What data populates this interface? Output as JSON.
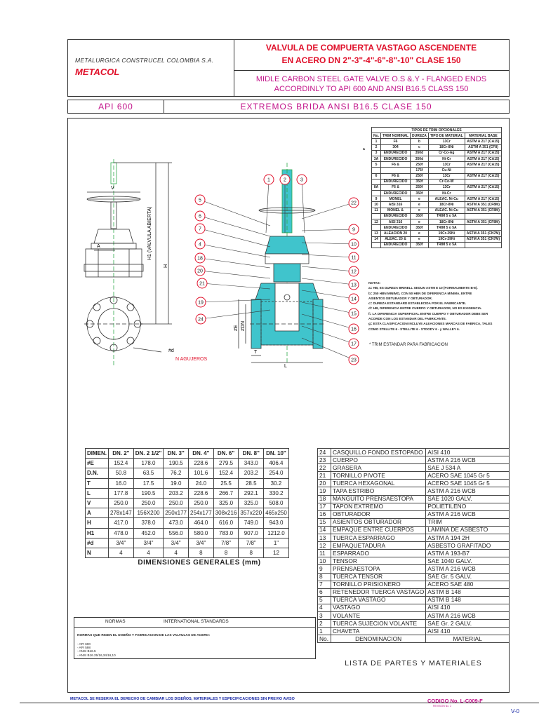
{
  "header": {
    "company": "METALURGICA CONSTRUCEL COLOMBIA S.A.",
    "brand": "METACOL",
    "title_line1": "VALVULA DE COMPUERTA VASTAGO ASCENDENTE",
    "title_line2": "EN ACERO DN 2\"-3\"-4\"-6\"-8\"-10\" CLASE 150",
    "subtitle_line1": "MIDLE CARBON STEEL GATE VALVE O.S &.Y - FLANGED ENDS",
    "subtitle_line2": "ACCORDINLY TO API 600 AND ANSI B16.5 CLASS 150"
  },
  "band": {
    "left": "API 600",
    "right": "EXTREMOS BRIDA ANSI B16.5 CLASE 150"
  },
  "drawing": {
    "left_labels": {
      "v": "V",
      "a": "A",
      "h1": "H1 (VALVULA ABIERTA)",
      "h": "H",
      "d": "#d",
      "holes": "N AGUJEROS"
    },
    "right_labels": {
      "e": "#E",
      "dn": "#DN",
      "t": "T",
      "l": "L"
    },
    "balloons_top": [
      "1",
      "2",
      "3"
    ],
    "balloons_left": [
      "5",
      "6",
      "7",
      "4",
      "18",
      "20",
      "21",
      "19",
      "24"
    ],
    "balloons_right": [
      "22",
      "9",
      "10",
      "11",
      "12",
      "13",
      "14",
      "15",
      "16",
      "17",
      "23"
    ]
  },
  "trim_table": {
    "group_header": "TIPOS DE TRIM      OPCIONALES",
    "columns": [
      "No.",
      "TRIM NOMINAL",
      "DUREZA",
      "TIPO DE MATERIAL",
      "MATERIAL BASE"
    ],
    "star": "*",
    "rows": [
      [
        "1",
        "F6",
        "b",
        "13Cr",
        "ASTM A 217 (CA15)"
      ],
      [
        "2",
        "304",
        "c",
        "18Cr-8Ni",
        "ASTM A 351 (CF8)"
      ],
      [
        "3",
        "ENDURECIDO",
        "350d",
        "Cr-Co-Ag",
        "ASTM A 217 (CA15)"
      ],
      [
        "3A",
        "ENDURECIDO",
        "350d",
        "Ni-Cr",
        "ASTM A 217 (CA15)"
      ],
      [
        "5",
        "F6 &",
        "250f",
        "13Cr",
        "ASTM A 217 (CA15)"
      ],
      [
        "",
        "",
        "175f",
        "Cu-Ni",
        ""
      ],
      [
        "6",
        "F6 &",
        "250f",
        "13Cr",
        "ASTM A 217 (CA15)"
      ],
      [
        "",
        "ENDURECIDO",
        "350f",
        "Cr-Co-W",
        ""
      ],
      [
        "8A",
        "F6 &",
        "250f",
        "13Cr",
        "ASTM A 217 (CA15)"
      ],
      [
        "",
        "ENDURECIDO",
        "350f",
        "Ni-Cr",
        ""
      ],
      [
        "9",
        "MONEL",
        "e",
        "ALEAC. Ni-Cu",
        "ASTM A 217 (CA15)"
      ],
      [
        "10",
        "AISI 316",
        "e",
        "18Cr-8Ni",
        "ASTM A 351 (CF8M)"
      ],
      [
        "11",
        "MONEL &",
        "e",
        "ALEAC. Ni-Cu",
        "ASTM A 351 (CF8M)"
      ],
      [
        "",
        "ENDURECIDO",
        "350f",
        "TRIM 5 o 5A",
        ""
      ],
      [
        "12",
        "AISI 316",
        "e",
        "18Cr-8Ni",
        "ASTM A 351 (CF8M)"
      ],
      [
        "",
        "ENDURECIDO",
        "350f",
        "TRIM 5 o 5A",
        ""
      ],
      [
        "13",
        "ALEACION 20",
        "e",
        "19Cr-29Ni",
        "ASTM A 351 (CN7M)"
      ],
      [
        "14",
        "ALEAC. 20 &",
        "e",
        "19Cr-29Ni",
        "ASTM A 351 (CN7M)"
      ],
      [
        "",
        "ENDURECIDO",
        "350f",
        "TRIM 5 o 5A",
        ""
      ]
    ]
  },
  "notes": {
    "title": "NOTAS:",
    "lines": [
      "a= HB, ES DUREZA BRINELL SEGUN ASTM E 10 (FORMALMENTE B-8).",
      "b= 250 HBN MINIMO, CON 50 HBN DE DIFERENCIA MINIMA, ENTRE",
      "   ASIENTOS OBTURADOR Y OBTURADOR.",
      "c= DUREZA ESTANDARD ESTABLECIDA POR EL FABRICANTE.",
      "d= HB, DIFERENCIA ENTRE CUERPO Y OBTURADOR, NO ES EXIGENCIA.",
      "f= LA DIFERENCIA SUPERFICIAL ENTRE CUERPO Y OBTURADOR DEBE SER",
      "   ACORDE CON LOS ESTANDAR DEL FABRICANTE.",
      "g= ESTA CLASIFICACION INCLUYE ALEACIONES MARCAS DE FABRICA, TALES",
      "   COMO STELLITE 6 - STELLITE 6 - STOODY 6 - y WALLEY 6."
    ],
    "trim_standard": "* TRIM ESTANDAR PARA FABRICACION"
  },
  "dimensions": {
    "title": "DIMENSIONES GENERALES (mm)",
    "header": [
      "DIMEN.",
      "DN. 2\"",
      "DN. 2 1/2\"",
      "DN. 3\"",
      "DN. 4\"",
      "DN. 6\"",
      "DN. 8\"",
      "DN. 10\""
    ],
    "rows": [
      [
        "#E",
        "152.4",
        "178.0",
        "190.5",
        "228.6",
        "279.5",
        "343.0",
        "406.4"
      ],
      [
        "D.N.",
        "50.8",
        "63.5",
        "76.2",
        "101.6",
        "152.4",
        "203.2",
        "254.0"
      ],
      [
        "T",
        "16.0",
        "17.5",
        "19.0",
        "24.0",
        "25.5",
        "28.5",
        "30.2"
      ],
      [
        "L",
        "177.8",
        "190.5",
        "203.2",
        "228.6",
        "266.7",
        "292.1",
        "330.2"
      ],
      [
        "V",
        "250.0",
        "250.0",
        "250.0",
        "250.0",
        "325.0",
        "325.0",
        "508.0"
      ],
      [
        "A",
        "278x147",
        "156X200",
        "250x177",
        "254x177",
        "308x216",
        "357x220",
        "465x250"
      ],
      [
        "H",
        "417.0",
        "378.0",
        "473.0",
        "464.0",
        "616.0",
        "749.0",
        "943.0"
      ],
      [
        "H1",
        "478.0",
        "452.0",
        "556.0",
        "580.0",
        "783.0",
        "907.0",
        "1212.0"
      ],
      [
        "#d",
        "3/4\"",
        "3/4\"",
        "3/4\"",
        "3/4\"",
        "7/8\"",
        "7/8\"",
        "1\""
      ],
      [
        "N",
        "4",
        "4",
        "4",
        "8",
        "8",
        "8",
        "12"
      ]
    ]
  },
  "parts": {
    "title": "LISTA DE PARTES Y MATERIALES",
    "footer_row": [
      "No.",
      "DENOMINACION",
      "MATERIAL"
    ],
    "rows": [
      [
        "24",
        "CASQUILLO FONDO ESTOPADO",
        "AISI 410"
      ],
      [
        "23",
        "CUERPO",
        "ASTM A 216 WCB"
      ],
      [
        "22",
        "GRASERA",
        "SAE J 534 A"
      ],
      [
        "21",
        "TORNILLO PIVOTE",
        "ACERO SAE 1045 Gr 5"
      ],
      [
        "20",
        "TUERCA HEXAGONAL",
        "ACERO SAE 1045 Gr 5"
      ],
      [
        "19",
        "TAPA ESTRIBO",
        "ASTM A 216 WCB"
      ],
      [
        "18",
        "MANGUITO PRENSAESTOPA",
        "SAE 1020 GALV."
      ],
      [
        "17",
        "TAPON EXTREMO",
        "POLIETILENO"
      ],
      [
        "16",
        "OBTURADOR",
        "ASTM A 216 WCB"
      ],
      [
        "15",
        "ASIENTOS OBTURADOR",
        "TRIM"
      ],
      [
        "14",
        "EMPAQUE ENTRE CUERPOS",
        "LAMINA DE ASBESTO"
      ],
      [
        "13",
        "TUERCA ESPARRAGO",
        "ASTM A 194 2H"
      ],
      [
        "12",
        "EMPAQUETADURA",
        "ASBESTO GRAFITADO"
      ],
      [
        "11",
        "ESPARRADO",
        "ASTM A 193-B7"
      ],
      [
        "10",
        "TENSOR",
        "SAE 1040 GALV."
      ],
      [
        "9",
        "PRENSAESTOPA",
        "ASTM A 216 WCB"
      ],
      [
        "8",
        "TUERCA TENSOR",
        "SAE Gr. 5 GALV."
      ],
      [
        "7",
        "TORNILLO PRISIONERO",
        "ACERO SAE 480"
      ],
      [
        "6",
        "RETENEDOR TUERCA VASTAGO",
        "ASTM B 148"
      ],
      [
        "5",
        "TUERCA VASTAGO",
        "ASTM B 148"
      ],
      [
        "4",
        "VASTAGO",
        "AISI 410"
      ],
      [
        "3",
        "VOLANTE",
        "ASTM A 216 WCB"
      ],
      [
        "2",
        "TUERCA SUJECION VOLANTE",
        "SAE Gr. 2 GALV."
      ],
      [
        "1",
        "CHAVETA",
        "AISI 410"
      ]
    ]
  },
  "standards": {
    "h1": "NORMAS",
    "h2": "INTERNATIONAL STANDARDS",
    "text": "NORMAS QUE RIGEN EL DISEÑO Y FABRICACION DE LAS VALVULAS DE ACERO:",
    "list": [
      "- API 600",
      "- API 598",
      "- ANSI B16.5",
      "- ANSI B16.25/16,34/16,10"
    ]
  },
  "footer": {
    "disclaimer": "METACOL SE RESERVA EL DERECHO DE CAMBIAR LOS DISEÑOS, MATERIALES Y ESPECIFICACIONES SIN PREVIO AVISO",
    "code": "CODIGO No. L-C009-F",
    "code_sub": "REVISION No. 2",
    "page": "V-0"
  },
  "colors": {
    "red": "#e0102a",
    "magenta": "#c2148a",
    "blue": "#1a2aa6",
    "cyan": "#40c4cc",
    "green": "#2ea84a"
  }
}
